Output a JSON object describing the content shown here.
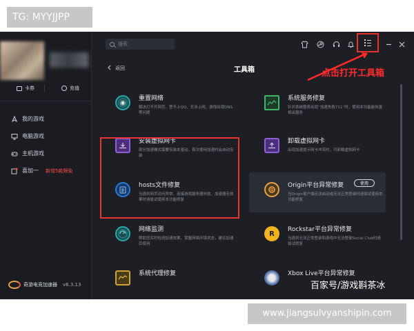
{
  "tg_badge": "TG: MYYJJPP",
  "sidebar": {
    "quick": [
      {
        "icon": "card-icon",
        "label": "卡券"
      },
      {
        "icon": "coin-icon",
        "label": "充值"
      }
    ],
    "nav": [
      {
        "icon": "rocket-icon",
        "label": "我的游戏",
        "badge": ""
      },
      {
        "icon": "monitor-icon",
        "label": "电脑游戏",
        "badge": ""
      },
      {
        "icon": "gamepad-icon",
        "label": "主机游戏",
        "badge": ""
      },
      {
        "icon": "invite-icon",
        "label": "喜加一",
        "badge": "新增5款限免"
      }
    ],
    "brand_name": "奇游电竞加速器",
    "version": "v6.3.13"
  },
  "topbar": {
    "search_placeholder": "搜索",
    "icons": [
      "shirt-icon",
      "steam-icon",
      "headset-icon",
      "bell-icon",
      "menu-icon",
      "minimize-icon",
      "close-icon"
    ]
  },
  "annotation": "点击打开工具箱",
  "main": {
    "back_label": "返回",
    "title": "工具箱",
    "tools": [
      {
        "name": "重置网络",
        "desc": "解决打不开网页、登不上QQ、无法上网、游戏出现DNS等问题",
        "icon": "network-reset-icon",
        "use": ""
      },
      {
        "name": "系统服务修复",
        "desc": "针对系统服务出现“加速失败711”时，使用本功能能恢复相关服务",
        "icon": "system-service-icon",
        "use": ""
      },
      {
        "name": "安装虚拟网卡",
        "desc": "部分加速模式需要安装本驱动，首次使用加速时会自动安装",
        "icon": "install-nic-icon",
        "use": ""
      },
      {
        "name": "卸载虚拟网卡",
        "desc": "出现加速提示网卡冲突时，可卸载虚拟网卡",
        "icon": "uninstall-nic-icon",
        "use": ""
      },
      {
        "name": "hosts文件修复",
        "desc": "当遇到网页访问异常、连接游戏服务器失败、加速器无效果时请尝试使用本功能修复",
        "icon": "hosts-fix-icon",
        "use": ""
      },
      {
        "name": "Origin平台异常修复",
        "desc": "当Origin客户端无法启动或无法正常登录时请尝试使用本功能修复",
        "icon": "origin-icon",
        "use": "使用"
      },
      {
        "name": "网络监测",
        "desc": "帮助您实时检测加速效果，掌握网络环境状态，建议加速后使用",
        "icon": "network-monitor-icon",
        "use": ""
      },
      {
        "name": "Rockstar平台异常修复",
        "desc": "当遇到无法正常登录和游戏中无法登录Social Club时请尝试修复",
        "icon": "rockstar-icon",
        "use": ""
      },
      {
        "name": "系统代理修复",
        "desc": "",
        "icon": "proxy-fix-icon",
        "use": ""
      },
      {
        "name": "Xbox Live平台异常修复",
        "desc": "",
        "icon": "xbox-icon",
        "use": ""
      }
    ]
  },
  "watermark_bottom_right": "百家号/游戏斟茶冰",
  "watermark_url": "www.jiangsulvyanshipin.com"
}
